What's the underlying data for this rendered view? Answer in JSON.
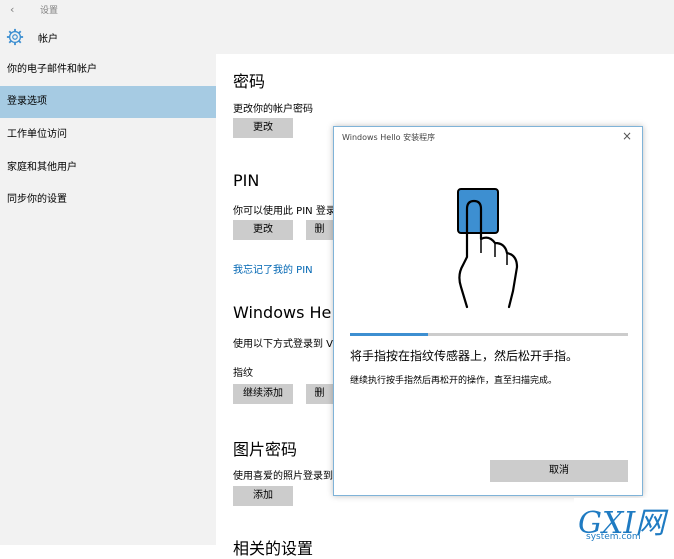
{
  "header": {
    "back_glyph": "‹",
    "app_title": "设置",
    "section_title": "帐户",
    "gear_icon": "gear-icon"
  },
  "sidebar": {
    "items": [
      {
        "label": "你的电子邮件和帐户"
      },
      {
        "label": "登录选项",
        "selected": true
      },
      {
        "label": "工作单位访问"
      },
      {
        "label": "家庭和其他用户"
      },
      {
        "label": "同步你的设置"
      }
    ]
  },
  "main": {
    "password": {
      "heading": "密码",
      "description": "更改你的帐户密码",
      "change_button": "更改"
    },
    "pin": {
      "heading": "PIN",
      "description": "你可以使用此 PIN 登录",
      "change_button": "更改",
      "remove_button": "删",
      "forgot_link": "我忘记了我的 PIN"
    },
    "hello": {
      "heading": "Windows He",
      "description": "使用以下方式登录到 V",
      "fingerprint_label": "指纹",
      "add_more_button": "继续添加",
      "remove_button": "删"
    },
    "picture_password": {
      "heading": "图片密码",
      "description": "使用喜爱的照片登录到",
      "add_button": "添加"
    },
    "related_heading": "相关的设置"
  },
  "dialog": {
    "title": "Windows Hello 安装程序",
    "close_glyph": "×",
    "progress_fraction": 0.28,
    "message": "将手指按在指纹传感器上，然后松开手指。",
    "sub_message": "继续执行按手指然后再松开的操作，直至扫描完成。",
    "cancel_button": "取消",
    "accent_color": "#3d8fd1"
  },
  "watermark": {
    "text": "GXI网",
    "sub": "system.com"
  }
}
